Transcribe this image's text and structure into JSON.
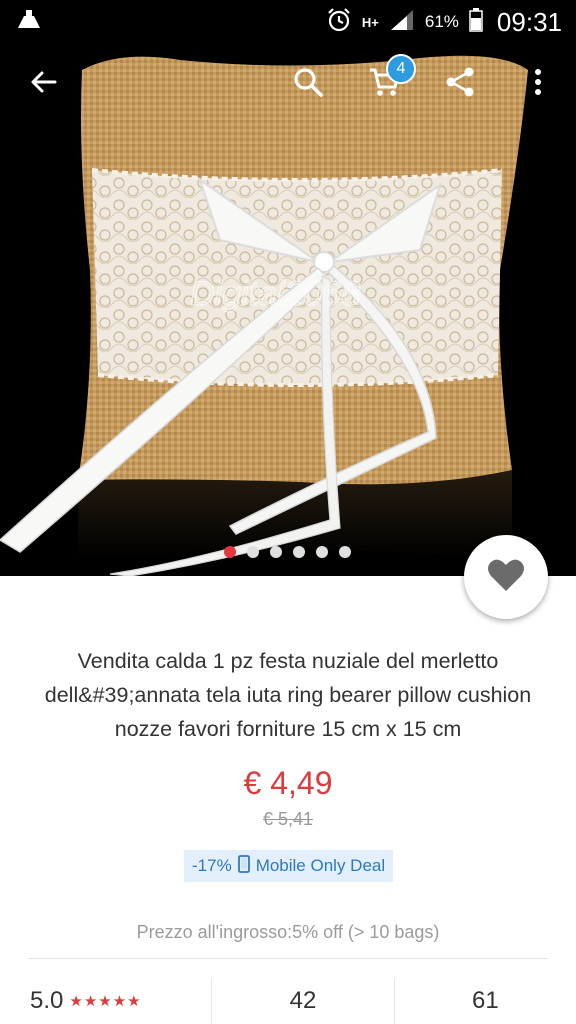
{
  "status_bar": {
    "battery_percent": "61%",
    "time": "09:31",
    "network": "H+"
  },
  "action_bar": {
    "cart_count": "4"
  },
  "gallery": {
    "watermark": "Digital2068",
    "total_images": 6,
    "active_index": 0
  },
  "product": {
    "title": "Vendita calda 1 pz festa nuziale del merletto dell&#39;annata tela iuta ring bearer pillow cushion nozze favori forniture 15 cm x 15 cm",
    "price": "€ 4,49",
    "old_price": "€ 5,41",
    "discount": "-17%",
    "deal_label": "Mobile Only Deal",
    "wholesale": "Prezzo all'ingrosso:5% off (> 10 bags)"
  },
  "stats": {
    "rating": "5.0",
    "stars": "★★★★★",
    "orders": "42",
    "feedback": "61"
  },
  "colors": {
    "accent_red": "#e0393e",
    "badge_blue": "#2d9be0",
    "deal_blue": "#2b78c5"
  }
}
